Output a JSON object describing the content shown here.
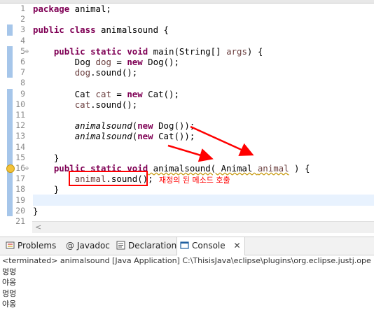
{
  "editor": {
    "lines": [
      {
        "n": "1",
        "tokens": [
          {
            "t": "package",
            "c": "kw"
          },
          {
            "t": " animal;"
          }
        ]
      },
      {
        "n": "2",
        "tokens": []
      },
      {
        "n": "3",
        "tokens": [
          {
            "t": "public",
            "c": "kw"
          },
          {
            "t": " "
          },
          {
            "t": "class",
            "c": "kw"
          },
          {
            "t": " animalsound {"
          }
        ]
      },
      {
        "n": "4",
        "tokens": []
      },
      {
        "n": "5",
        "tokens": [
          {
            "t": "    "
          },
          {
            "t": "public",
            "c": "kw"
          },
          {
            "t": " "
          },
          {
            "t": "static",
            "c": "kw"
          },
          {
            "t": " "
          },
          {
            "t": "void",
            "c": "kw"
          },
          {
            "t": " main(String[] "
          },
          {
            "t": "args",
            "c": "var"
          },
          {
            "t": ") {"
          }
        ]
      },
      {
        "n": "6",
        "tokens": [
          {
            "t": "        Dog "
          },
          {
            "t": "dog",
            "c": "var"
          },
          {
            "t": " = "
          },
          {
            "t": "new",
            "c": "kw"
          },
          {
            "t": " Dog();"
          }
        ]
      },
      {
        "n": "7",
        "tokens": [
          {
            "t": "        "
          },
          {
            "t": "dog",
            "c": "var"
          },
          {
            "t": ".sound();"
          }
        ]
      },
      {
        "n": "8",
        "tokens": []
      },
      {
        "n": "9",
        "tokens": [
          {
            "t": "        Cat "
          },
          {
            "t": "cat",
            "c": "var"
          },
          {
            "t": " = "
          },
          {
            "t": "new",
            "c": "kw"
          },
          {
            "t": " Cat();"
          }
        ]
      },
      {
        "n": "10",
        "tokens": [
          {
            "t": "        "
          },
          {
            "t": "cat",
            "c": "var"
          },
          {
            "t": ".sound();"
          }
        ]
      },
      {
        "n": "11",
        "tokens": []
      },
      {
        "n": "12",
        "tokens": [
          {
            "t": "        "
          },
          {
            "t": "animalsound",
            "c": "ital"
          },
          {
            "t": "("
          },
          {
            "t": "new",
            "c": "kw"
          },
          {
            "t": " Dog());"
          }
        ]
      },
      {
        "n": "13",
        "tokens": [
          {
            "t": "        "
          },
          {
            "t": "animalsound",
            "c": "ital"
          },
          {
            "t": "("
          },
          {
            "t": "new",
            "c": "kw"
          },
          {
            "t": " Cat());"
          }
        ]
      },
      {
        "n": "14",
        "tokens": []
      },
      {
        "n": "15",
        "tokens": [
          {
            "t": "    }"
          }
        ]
      },
      {
        "n": "16",
        "tokens": [
          {
            "t": "    "
          },
          {
            "t": "public",
            "c": "kw"
          },
          {
            "t": " "
          },
          {
            "t": "static",
            "c": "kw"
          },
          {
            "t": " "
          },
          {
            "t": "void",
            "c": "kw"
          },
          {
            "t": " animalsound( Animal ",
            "c": "sq"
          },
          {
            "t": "animal",
            "c": "var sq"
          },
          {
            "t": " ) {"
          }
        ]
      },
      {
        "n": "17",
        "tokens": [
          {
            "t": "        "
          },
          {
            "t": "animal",
            "c": "var"
          },
          {
            "t": ".sound();"
          }
        ]
      },
      {
        "n": "18",
        "tokens": [
          {
            "t": "    }"
          }
        ]
      },
      {
        "n": "19",
        "tokens": []
      },
      {
        "n": "20",
        "tokens": [
          {
            "t": "}"
          }
        ]
      },
      {
        "n": "21",
        "tokens": []
      }
    ]
  },
  "annotation": {
    "text": "재정의 된 메소드 호출",
    "color": "#ff0000"
  },
  "panel": {
    "tabs": [
      {
        "label": "Problems",
        "icon": "problems-icon"
      },
      {
        "label": "Javadoc",
        "icon": "at-icon"
      },
      {
        "label": "Declaration",
        "icon": "declaration-icon"
      },
      {
        "label": "Console",
        "icon": "console-icon",
        "active": true
      }
    ],
    "console_header": "<terminated> animalsound [Java Application] C:\\ThisisJava\\eclipse\\plugins\\org.eclipse.justj.ope",
    "output": [
      "멍멍",
      "야옹",
      "멍멍",
      "야옹"
    ]
  },
  "colors": {
    "keyword": "#7f0055",
    "variable": "#6a3e3e",
    "accent": "#ff0000",
    "highlight": "#e8f2fe"
  }
}
